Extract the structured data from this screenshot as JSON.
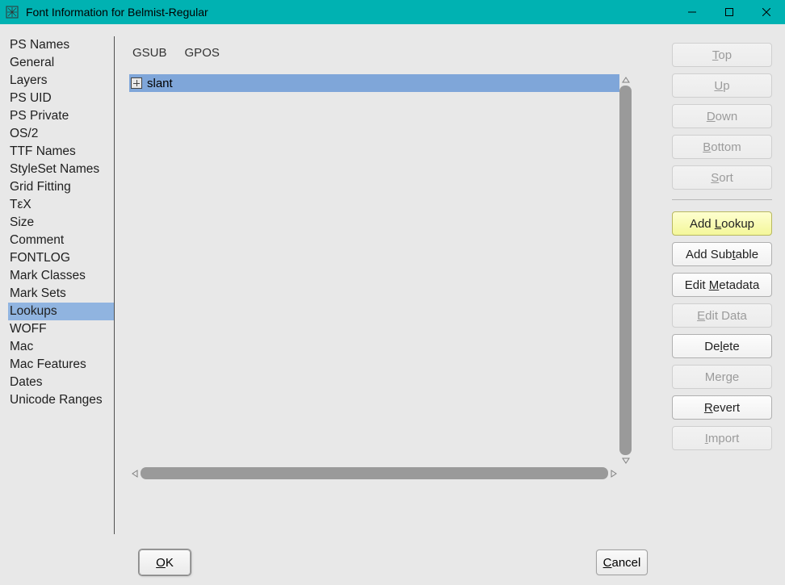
{
  "window": {
    "title": "Font Information for Belmist-Regular"
  },
  "sidebar": {
    "items": [
      {
        "label": "PS Names"
      },
      {
        "label": "General"
      },
      {
        "label": "Layers"
      },
      {
        "label": "PS UID"
      },
      {
        "label": "PS Private"
      },
      {
        "label": "OS/2"
      },
      {
        "label": "TTF Names"
      },
      {
        "label": "StyleSet Names"
      },
      {
        "label": "Grid Fitting"
      },
      {
        "label": "TεX"
      },
      {
        "label": "Size"
      },
      {
        "label": "Comment"
      },
      {
        "label": "FONTLOG"
      },
      {
        "label": "Mark Classes"
      },
      {
        "label": "Mark Sets"
      },
      {
        "label": "Lookups",
        "selected": true
      },
      {
        "label": "WOFF"
      },
      {
        "label": "Mac"
      },
      {
        "label": "Mac Features"
      },
      {
        "label": "Dates"
      },
      {
        "label": "Unicode Ranges"
      }
    ]
  },
  "tabs": {
    "gsub": "GSUB",
    "gpos": "GPOS"
  },
  "lookups": [
    {
      "name": "slant"
    }
  ],
  "buttons": {
    "top_pre": "",
    "top_ud": "T",
    "top_post": "op",
    "up_pre": "",
    "up_ud": "U",
    "up_post": "p",
    "down_pre": "",
    "down_ud": "D",
    "down_post": "own",
    "bottom_pre": "",
    "bottom_ud": "B",
    "bottom_post": "ottom",
    "sort_pre": "",
    "sort_ud": "S",
    "sort_post": "ort",
    "addlookup_pre": "Add ",
    "addlookup_ud": "L",
    "addlookup_post": "ookup",
    "addsubtable_pre": "Add Sub",
    "addsubtable_ud": "t",
    "addsubtable_post": "able",
    "editmeta_pre": "Edit ",
    "editmeta_ud": "M",
    "editmeta_post": "etadata",
    "editdata_pre": "",
    "editdata_ud": "E",
    "editdata_post": "dit Data",
    "delete_pre": "De",
    "delete_ud": "l",
    "delete_post": "ete",
    "merge_pre": "Mer",
    "merge_ud": "g",
    "merge_post": "e",
    "revert_pre": "",
    "revert_ud": "R",
    "revert_post": "evert",
    "import_pre": "",
    "import_ud": "I",
    "import_post": "mport",
    "ok_pre": "",
    "ok_ud": "O",
    "ok_post": "K",
    "cancel_pre": "",
    "cancel_ud": "C",
    "cancel_post": "ancel"
  }
}
